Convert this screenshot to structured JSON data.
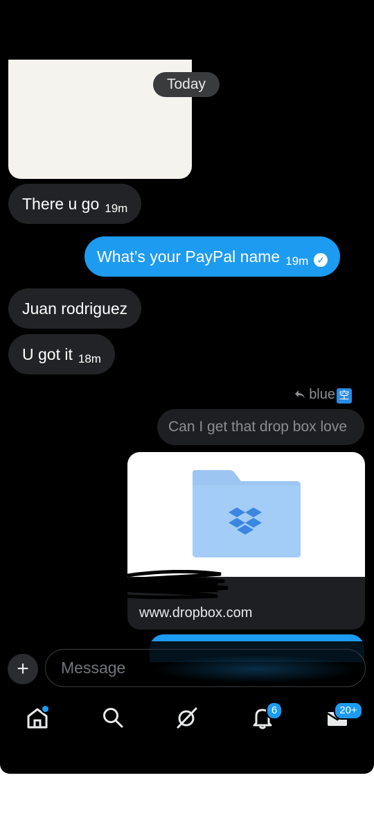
{
  "thread": {
    "date_divider": "Today",
    "messages": [
      {
        "text": "There u go",
        "time": "19m"
      },
      {
        "text": "What’s your PayPal name",
        "time": "19m"
      },
      {
        "text": "Juan rodriguez",
        "time": ""
      },
      {
        "text": "U got it",
        "time": "18m"
      }
    ],
    "reply": {
      "reply_to_name": "blue",
      "reply_to_badge": "空",
      "quoted_text": "Can I get that drop box love"
    },
    "link_card": {
      "domain": "www.dropbox.com"
    }
  },
  "composer": {
    "placeholder": "Message",
    "plus_label": "+"
  },
  "tabbar": {
    "notifications_badge": "6",
    "messages_badge": "20+"
  },
  "colors": {
    "accent": "#1d9bf0",
    "background": "#000000",
    "incoming_bubble": "#222326"
  }
}
